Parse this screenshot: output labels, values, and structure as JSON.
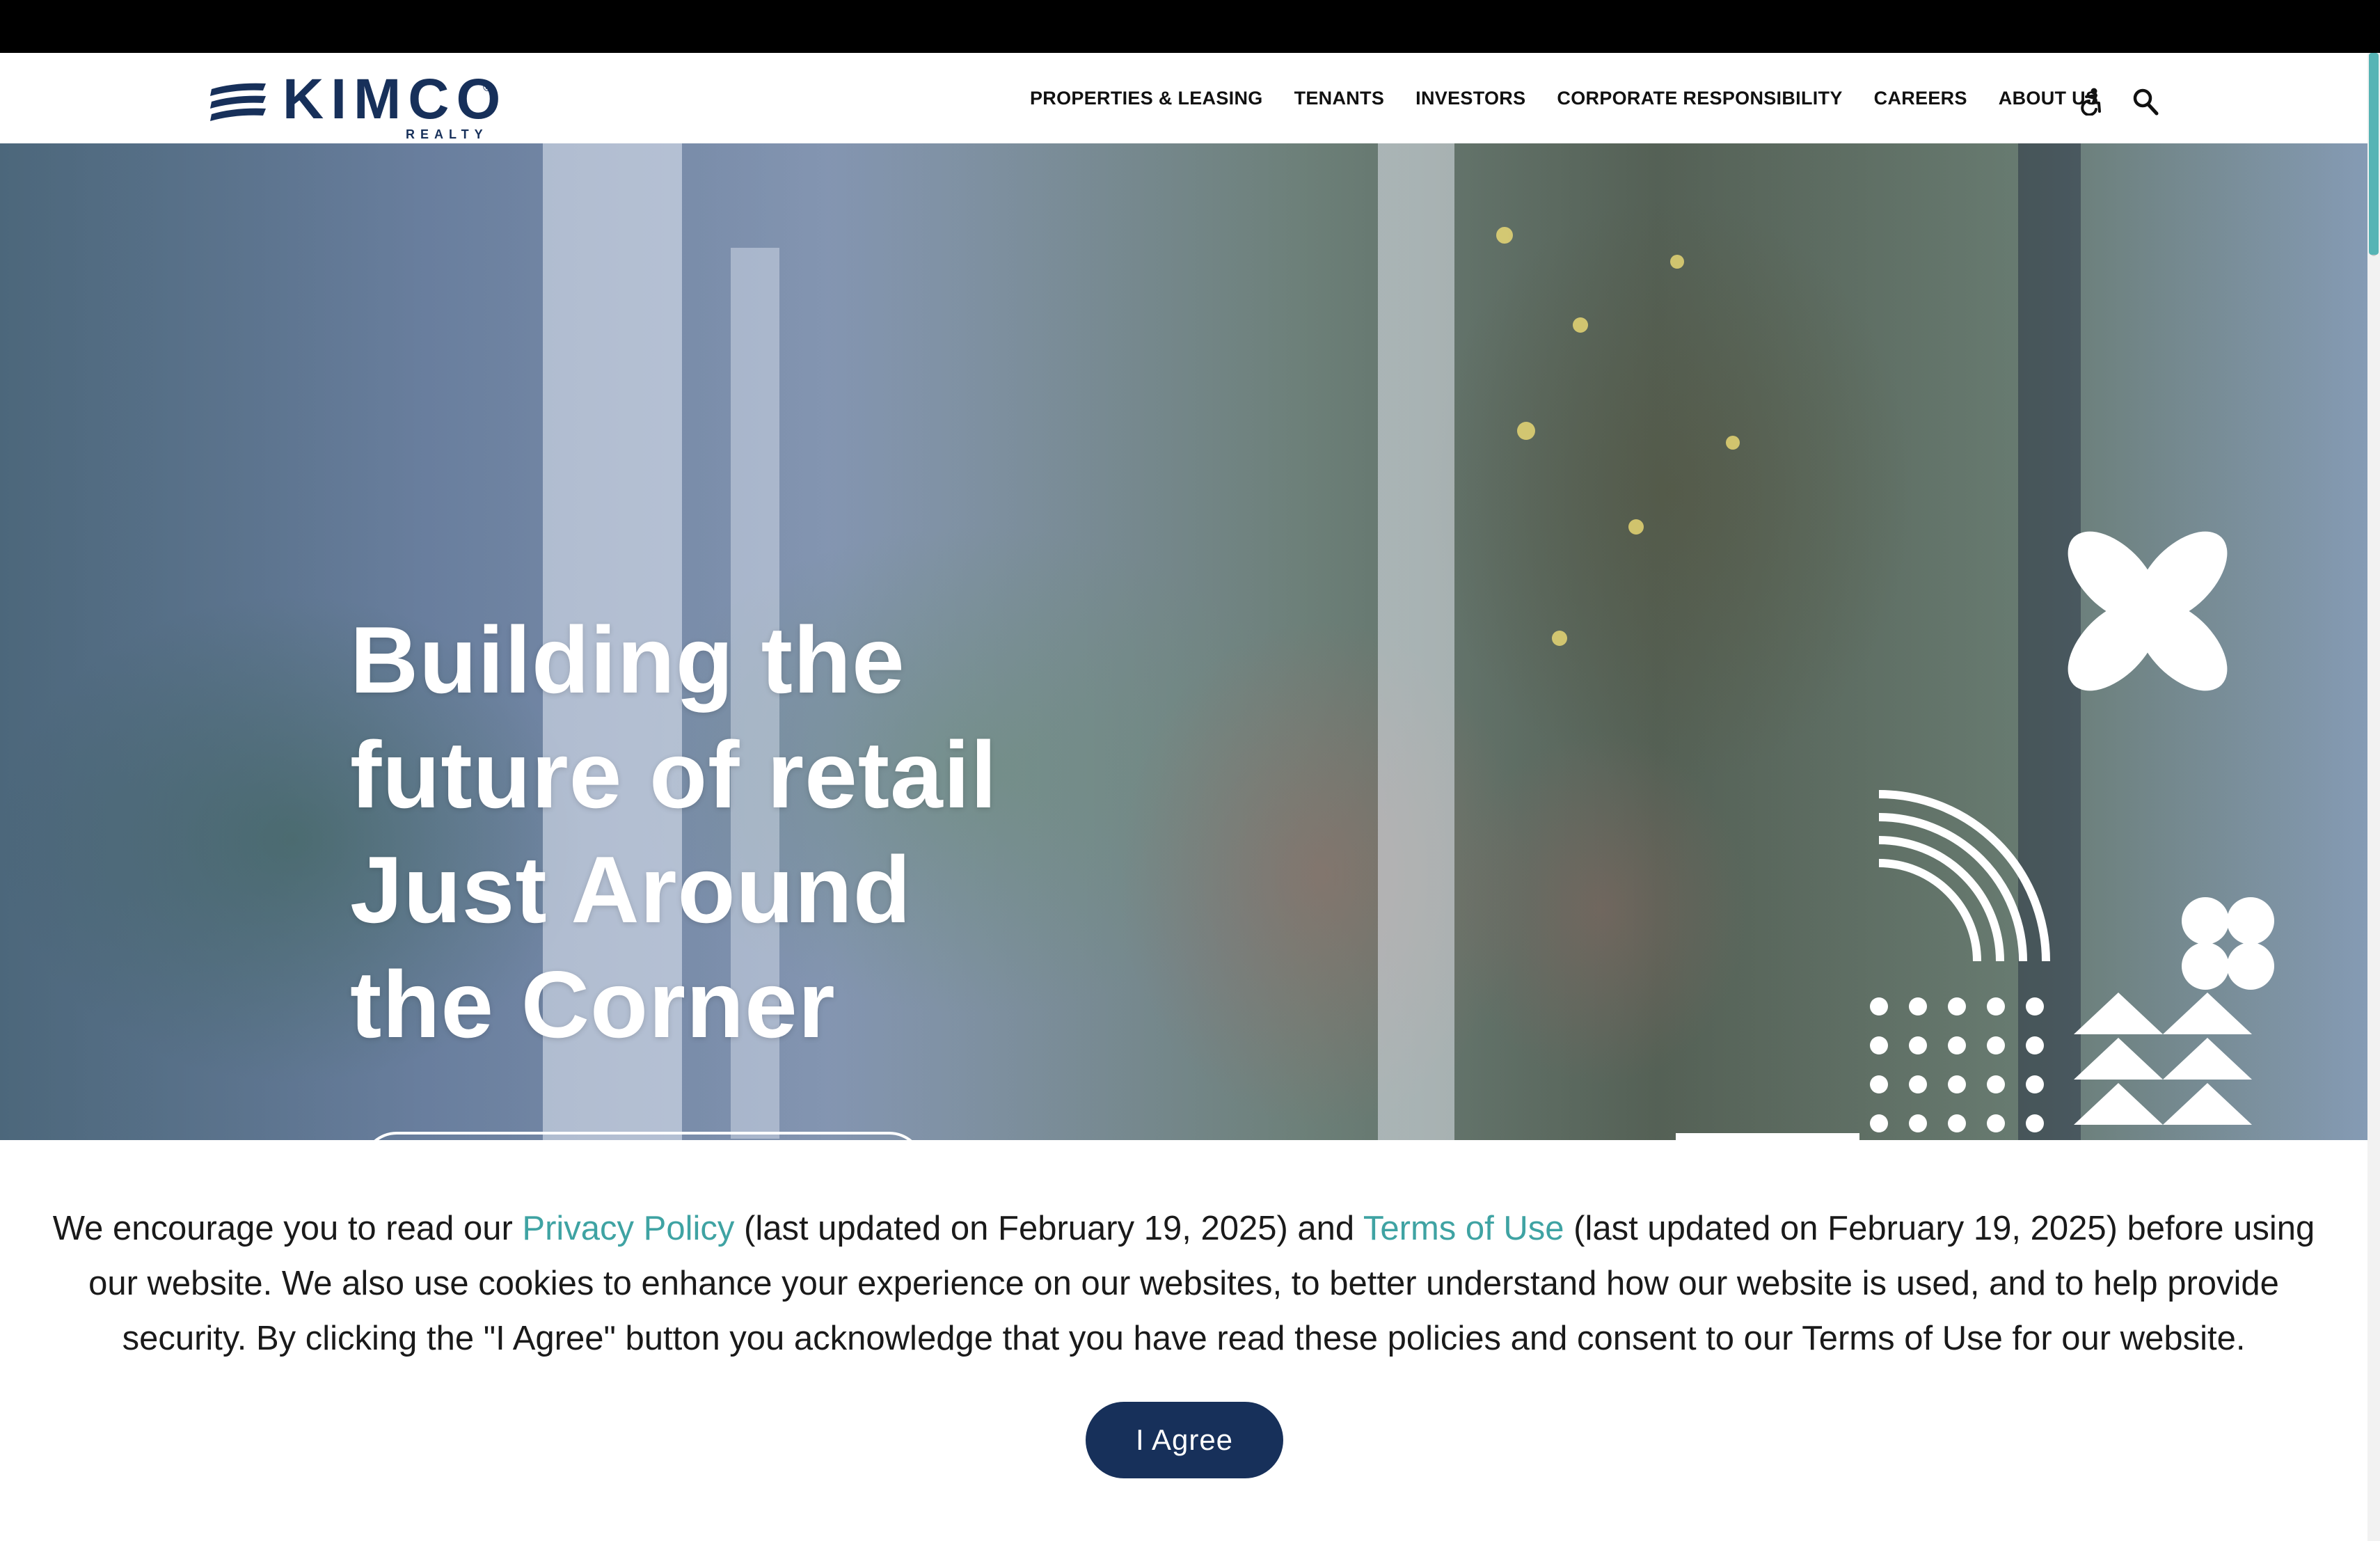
{
  "brand": {
    "name": "KIMCO",
    "sub": "REALTY",
    "registered": "®",
    "color": "#17305a"
  },
  "nav": {
    "items": [
      {
        "label": "PROPERTIES & LEASING"
      },
      {
        "label": "TENANTS"
      },
      {
        "label": "INVESTORS"
      },
      {
        "label": "CORPORATE RESPONSIBILITY"
      },
      {
        "label": "CAREERS"
      },
      {
        "label": "ABOUT US"
      }
    ],
    "icons": [
      "accessibility-icon",
      "search-icon"
    ]
  },
  "hero": {
    "title_lines": [
      "Building the",
      "future of retail",
      "Just Around",
      "the Corner"
    ]
  },
  "cookie": {
    "text_before": "We encourage you to read our ",
    "privacy_link": "Privacy Policy",
    "text_middle": " (last updated on February 19, 2025) and ",
    "terms_link": "Terms of Use",
    "text_after": " (last updated on February 19, 2025) before using our website. We also use cookies to enhance your experience on our websites, to better understand how our website is used, and to help provide security. By clicking the \"I Agree\" button you acknowledge that you have read these policies and consent to our Terms of Use for our website.",
    "agree_label": "I Agree",
    "link_color": "#3fa3a3"
  }
}
